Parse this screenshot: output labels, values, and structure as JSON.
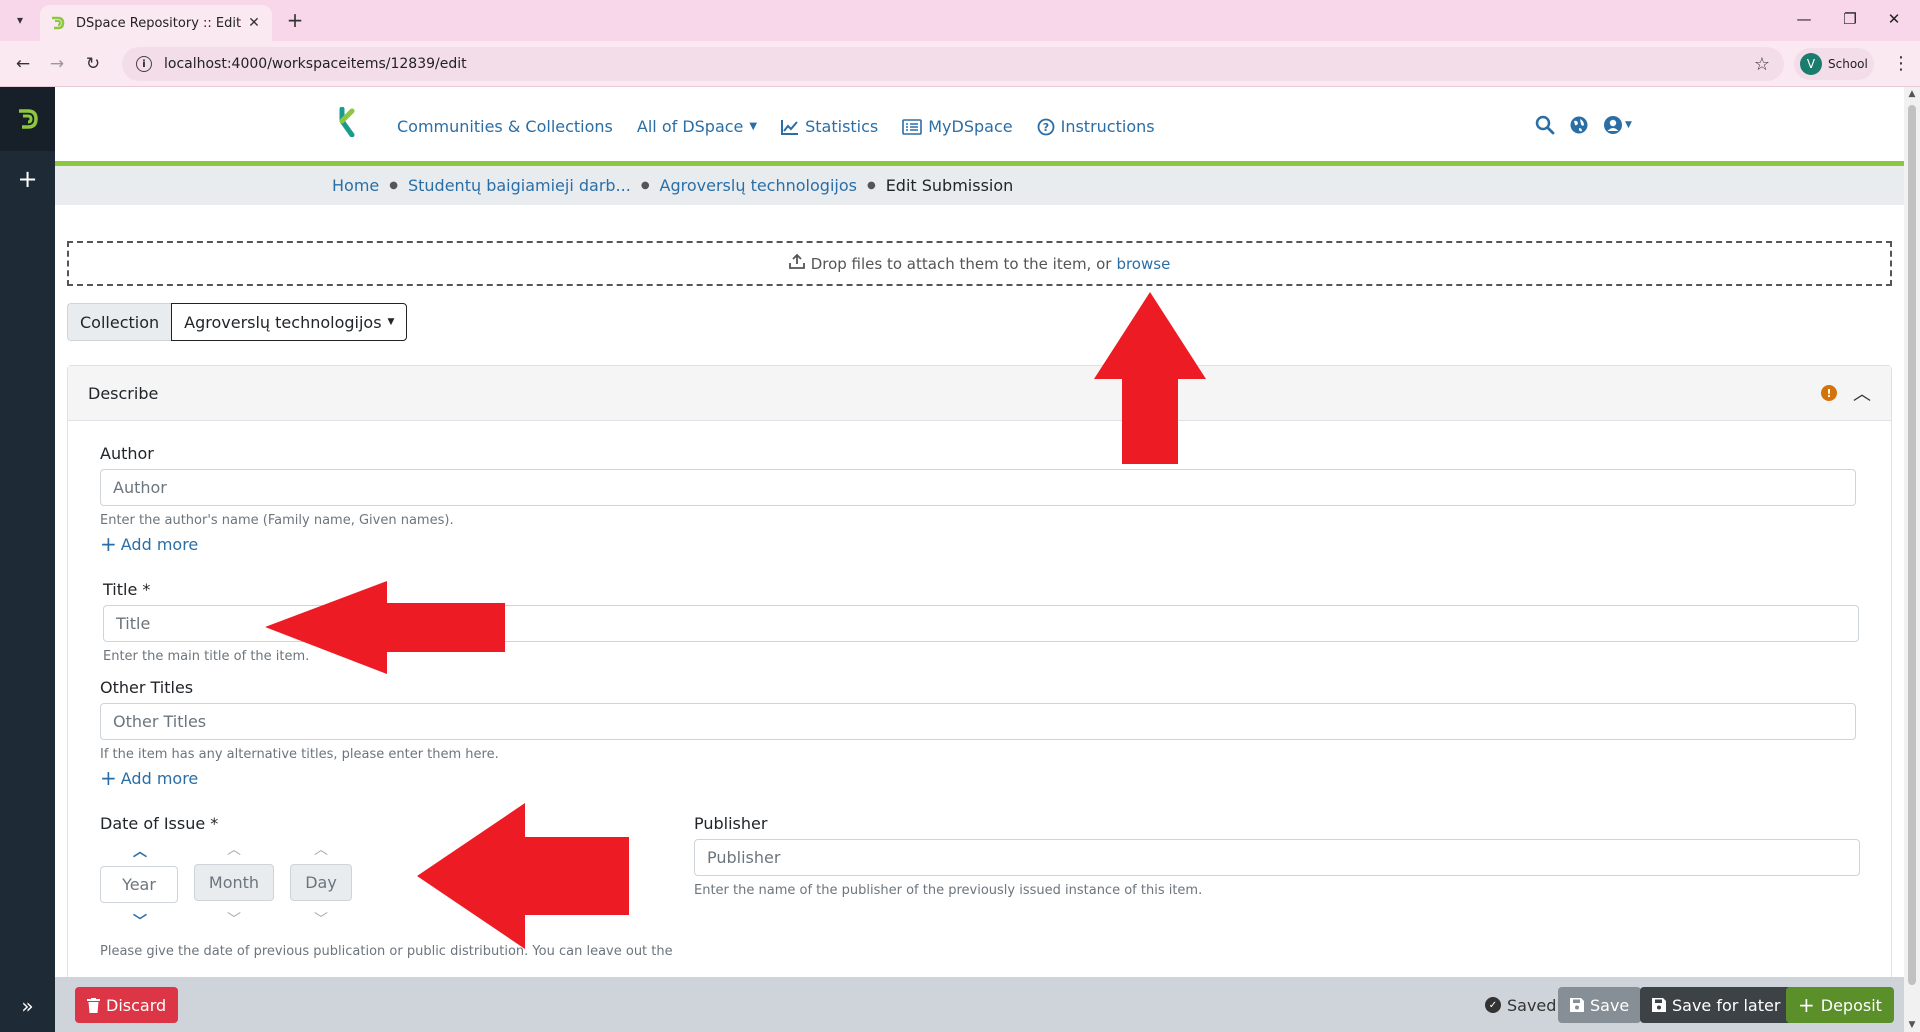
{
  "browser": {
    "tab_title": "DSpace Repository :: Edit Subm",
    "url": "localhost:4000/workspaceitems/12839/edit",
    "profile_initial": "V",
    "profile_name": "School"
  },
  "header": {
    "nav": [
      {
        "label": "Communities & Collections"
      },
      {
        "label": "All of DSpace"
      },
      {
        "label": "Statistics"
      },
      {
        "label": "MyDSpace"
      },
      {
        "label": "Instructions"
      }
    ]
  },
  "breadcrumb": [
    "Home",
    "Studentų baigiamieji darb...",
    "Agroverslų technologijos",
    "Edit Submission"
  ],
  "upload": {
    "text": "Drop files to attach them to the item, or",
    "link": "browse"
  },
  "collection": {
    "label": "Collection",
    "value": "Agroverslų technologijos"
  },
  "section": {
    "title": "Describe",
    "warning_glyph": "!"
  },
  "fields": {
    "author": {
      "label": "Author",
      "placeholder": "Author",
      "hint": "Enter the author's name (Family name, Given names).",
      "add_more": "Add more"
    },
    "title": {
      "label": "Title *",
      "placeholder": "Title",
      "hint": "Enter the main title of the item."
    },
    "other_titles": {
      "label": "Other Titles",
      "placeholder": "Other Titles",
      "hint": "If the item has any alternative titles, please enter them here.",
      "add_more": "Add more"
    },
    "date": {
      "label": "Date of Issue *",
      "year": "Year",
      "month": "Month",
      "day": "Day",
      "hint": "Please give the date of previous publication or public distribution. You can leave out the"
    },
    "publisher": {
      "label": "Publisher",
      "placeholder": "Publisher",
      "hint": "Enter the name of the publisher of the previously issued instance of this item."
    }
  },
  "footer": {
    "discard": "Discard",
    "saved": "Saved",
    "save": "Save",
    "save_later": "Save for later",
    "deposit": "Deposit"
  },
  "colors": {
    "accent": "#2b6ea6",
    "header_rule": "#8dc63f",
    "discard": "#dc3545",
    "deposit": "#5a8f29",
    "annotation_arrow": "#ed1c24"
  }
}
